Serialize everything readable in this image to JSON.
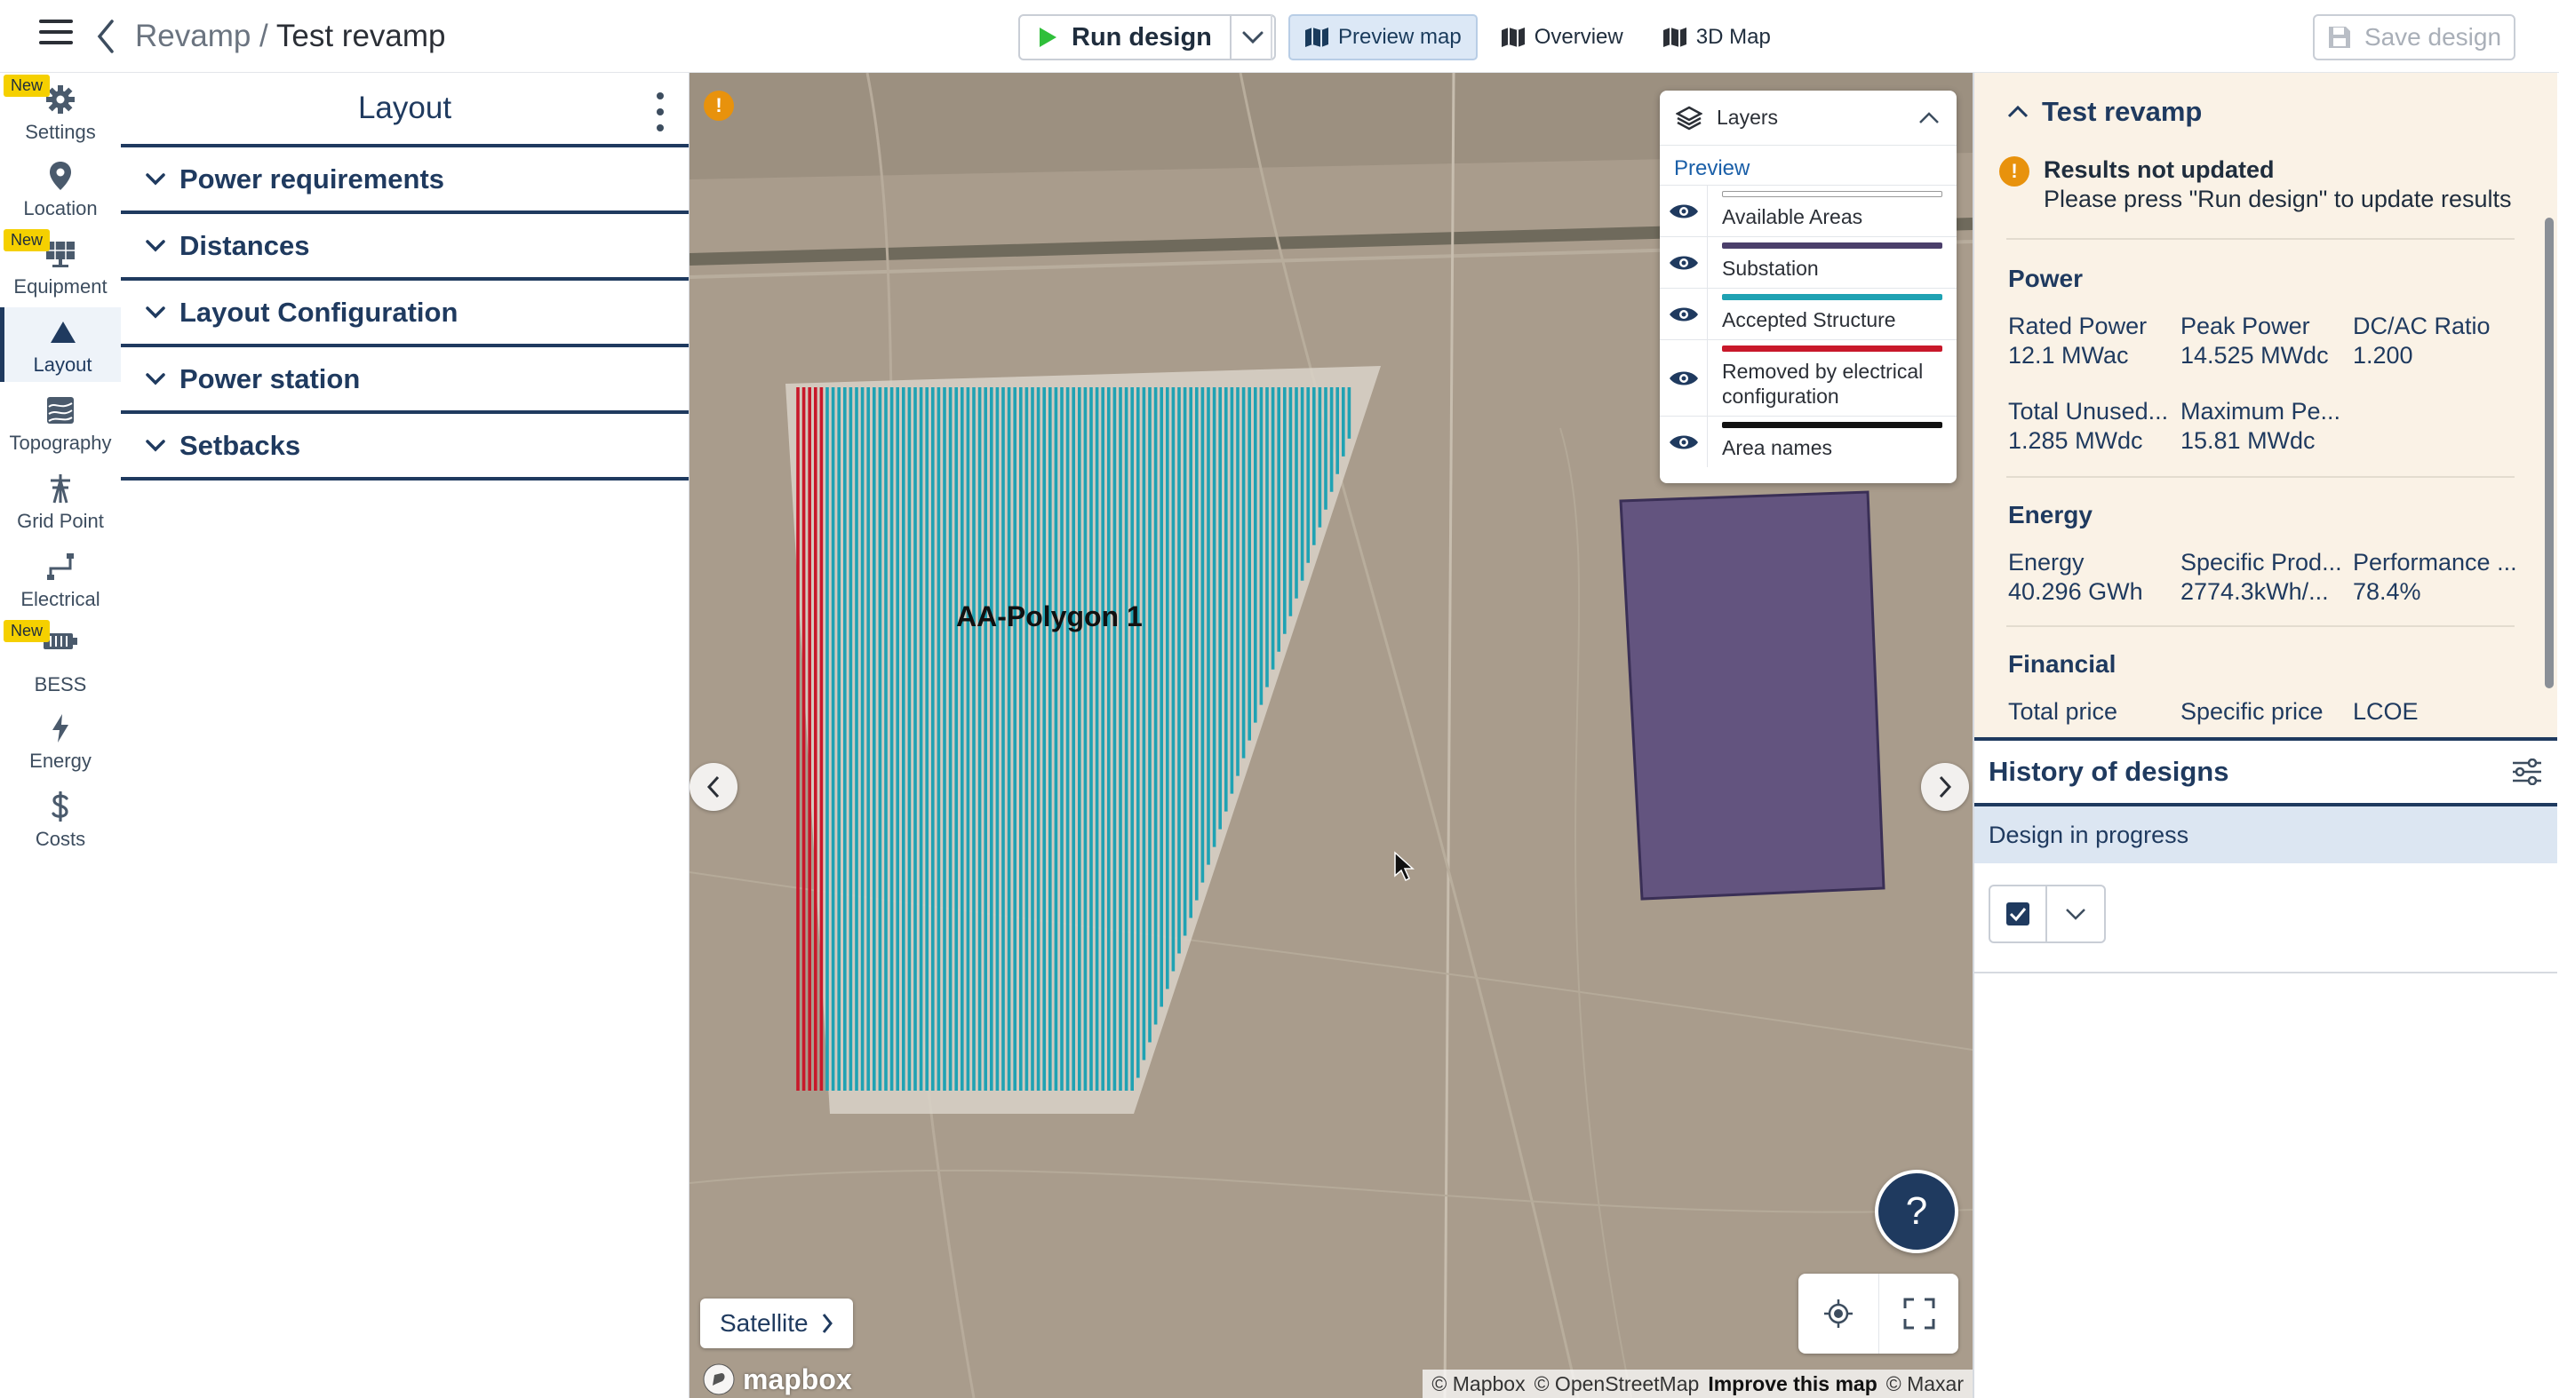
{
  "header": {
    "breadcrumb_parent": "Revamp",
    "breadcrumb_sep": " / ",
    "breadcrumb_current": "Test revamp",
    "run_label": "Run design",
    "tabs": [
      {
        "label": "Preview map",
        "icon": "map-icon",
        "active": true
      },
      {
        "label": "Overview",
        "icon": "map-icon",
        "active": false
      },
      {
        "label": "3D Map",
        "icon": "map-icon",
        "active": false
      }
    ],
    "save_label": "Save design"
  },
  "sidebar": {
    "new_badge": "New",
    "items": [
      {
        "label": "Settings",
        "icon": "gear-icon",
        "badge": true
      },
      {
        "label": "Location",
        "icon": "location-pin-icon",
        "badge": false
      },
      {
        "label": "Equipment",
        "icon": "solar-panel-icon",
        "badge": true
      },
      {
        "label": "Layout",
        "icon": "triangle-icon",
        "badge": false,
        "active": true
      },
      {
        "label": "Topography",
        "icon": "topography-icon",
        "badge": false
      },
      {
        "label": "Grid Point",
        "icon": "grid-tower-icon",
        "badge": false
      },
      {
        "label": "Electrical",
        "icon": "electrical-icon",
        "badge": false
      },
      {
        "label": "BESS",
        "icon": "battery-icon",
        "badge": true
      },
      {
        "label": "Energy",
        "icon": "lightning-icon",
        "badge": false
      },
      {
        "label": "Costs",
        "icon": "dollar-icon",
        "badge": false
      }
    ]
  },
  "panel": {
    "title": "Layout",
    "sections": [
      "Power requirements",
      "Distances",
      "Layout Configuration",
      "Power station",
      "Setbacks"
    ]
  },
  "map": {
    "polygon_label": "AA-Polygon 1",
    "warning_symbol": "!",
    "layers": {
      "title": "Layers",
      "group": "Preview",
      "items": [
        {
          "label": "Available Areas",
          "color": "#ffffff"
        },
        {
          "label": "Substation",
          "color": "#4b3f6b"
        },
        {
          "label": "Accepted Structure",
          "color": "#1fa2b3"
        },
        {
          "label": "Removed by electrical configuration",
          "color": "#c8182a"
        },
        {
          "label": "Area names",
          "color": "#111111"
        }
      ]
    },
    "help_symbol": "?",
    "basemap_label": "Satellite",
    "mapbox_logo": "mapbox",
    "attribution": {
      "mapbox": "© Mapbox",
      "osm": "© OpenStreetMap",
      "improve": "Improve this map",
      "maxar": "© Maxar"
    }
  },
  "results": {
    "title": "Test revamp",
    "warning_title": "Results not updated",
    "warning_text": "Please press \"Run design\" to update results",
    "sections": {
      "power": "Power",
      "energy": "Energy",
      "financial": "Financial"
    },
    "power": [
      {
        "label": "Rated Power",
        "value": "12.1 MWac"
      },
      {
        "label": "Peak Power",
        "value": "14.525 MWdc"
      },
      {
        "label": "DC/AC Ratio",
        "value": "1.200"
      },
      {
        "label": "Total Unused...",
        "value": "1.285 MWdc"
      },
      {
        "label": "Maximum Pe...",
        "value": "15.81 MWdc"
      }
    ],
    "energy": [
      {
        "label": "Energy",
        "value": "40.296 GWh"
      },
      {
        "label": "Specific Prod...",
        "value": "2774.3kWh/..."
      },
      {
        "label": "Performance ...",
        "value": "78.4%"
      }
    ],
    "financial": [
      {
        "label": "Total price",
        "value": ""
      },
      {
        "label": "Specific price",
        "value": ""
      },
      {
        "label": "LCOE",
        "value": ""
      }
    ]
  },
  "history": {
    "title": "History of designs",
    "row_label": "Design in progress"
  }
}
